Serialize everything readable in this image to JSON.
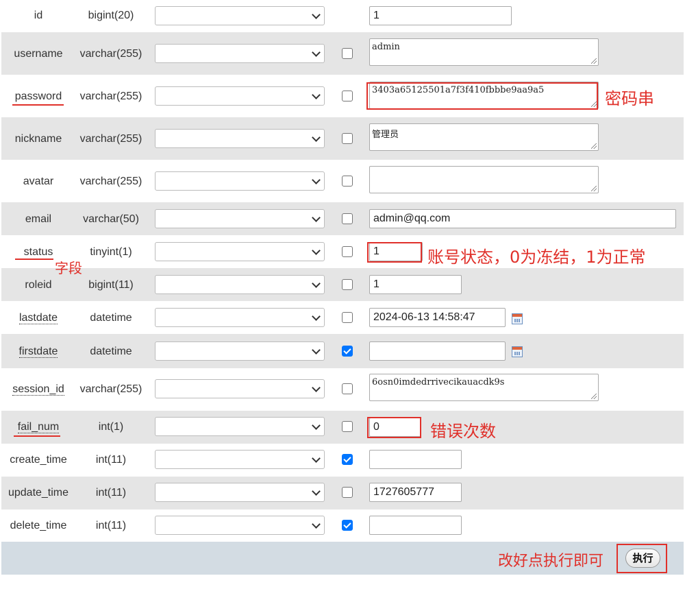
{
  "rows": [
    {
      "name": "id",
      "type": "bigint(20)",
      "null_checked": false,
      "value": "1"
    },
    {
      "name": "username",
      "type": "varchar(255)",
      "null_checked": false,
      "value": "admin"
    },
    {
      "name": "password",
      "type": "varchar(255)",
      "null_checked": false,
      "value": "3403a65125501a7f3f410fbbbe9aa9a5"
    },
    {
      "name": "nickname",
      "type": "varchar(255)",
      "null_checked": false,
      "value": "管理员"
    },
    {
      "name": "avatar",
      "type": "varchar(255)",
      "null_checked": false,
      "value": ""
    },
    {
      "name": "email",
      "type": "varchar(50)",
      "null_checked": false,
      "value": "admin@qq.com"
    },
    {
      "name": "status",
      "type": "tinyint(1)",
      "null_checked": false,
      "value": "1"
    },
    {
      "name": "roleid",
      "type": "bigint(11)",
      "null_checked": false,
      "value": "1"
    },
    {
      "name": "lastdate",
      "type": "datetime",
      "null_checked": false,
      "value": "2024-06-13 14:58:47"
    },
    {
      "name": "firstdate",
      "type": "datetime",
      "null_checked": true,
      "value": ""
    },
    {
      "name": "session_id",
      "type": "varchar(255)",
      "null_checked": false,
      "value": "6osn0imdedrrivecikauacdk9s"
    },
    {
      "name": "fail_num",
      "type": "int(1)",
      "null_checked": false,
      "value": "0"
    },
    {
      "name": "create_time",
      "type": "int(11)",
      "null_checked": true,
      "value": ""
    },
    {
      "name": "update_time",
      "type": "int(11)",
      "null_checked": false,
      "value": "1727605777"
    },
    {
      "name": "delete_time",
      "type": "int(11)",
      "null_checked": true,
      "value": ""
    }
  ],
  "annotations": {
    "password": "密码串",
    "status_field": "字段",
    "status": "账号状态，0为冻结，1为正常",
    "fail_num": "错误次数",
    "execute_hint": "改好点执行即可"
  },
  "footer": {
    "execute_label": "执行"
  },
  "colors": {
    "row_alt": "#e5e5e5",
    "footer": "#d3dce3",
    "annotation": "#e0302a",
    "checkbox_checked": "#0075ff"
  }
}
